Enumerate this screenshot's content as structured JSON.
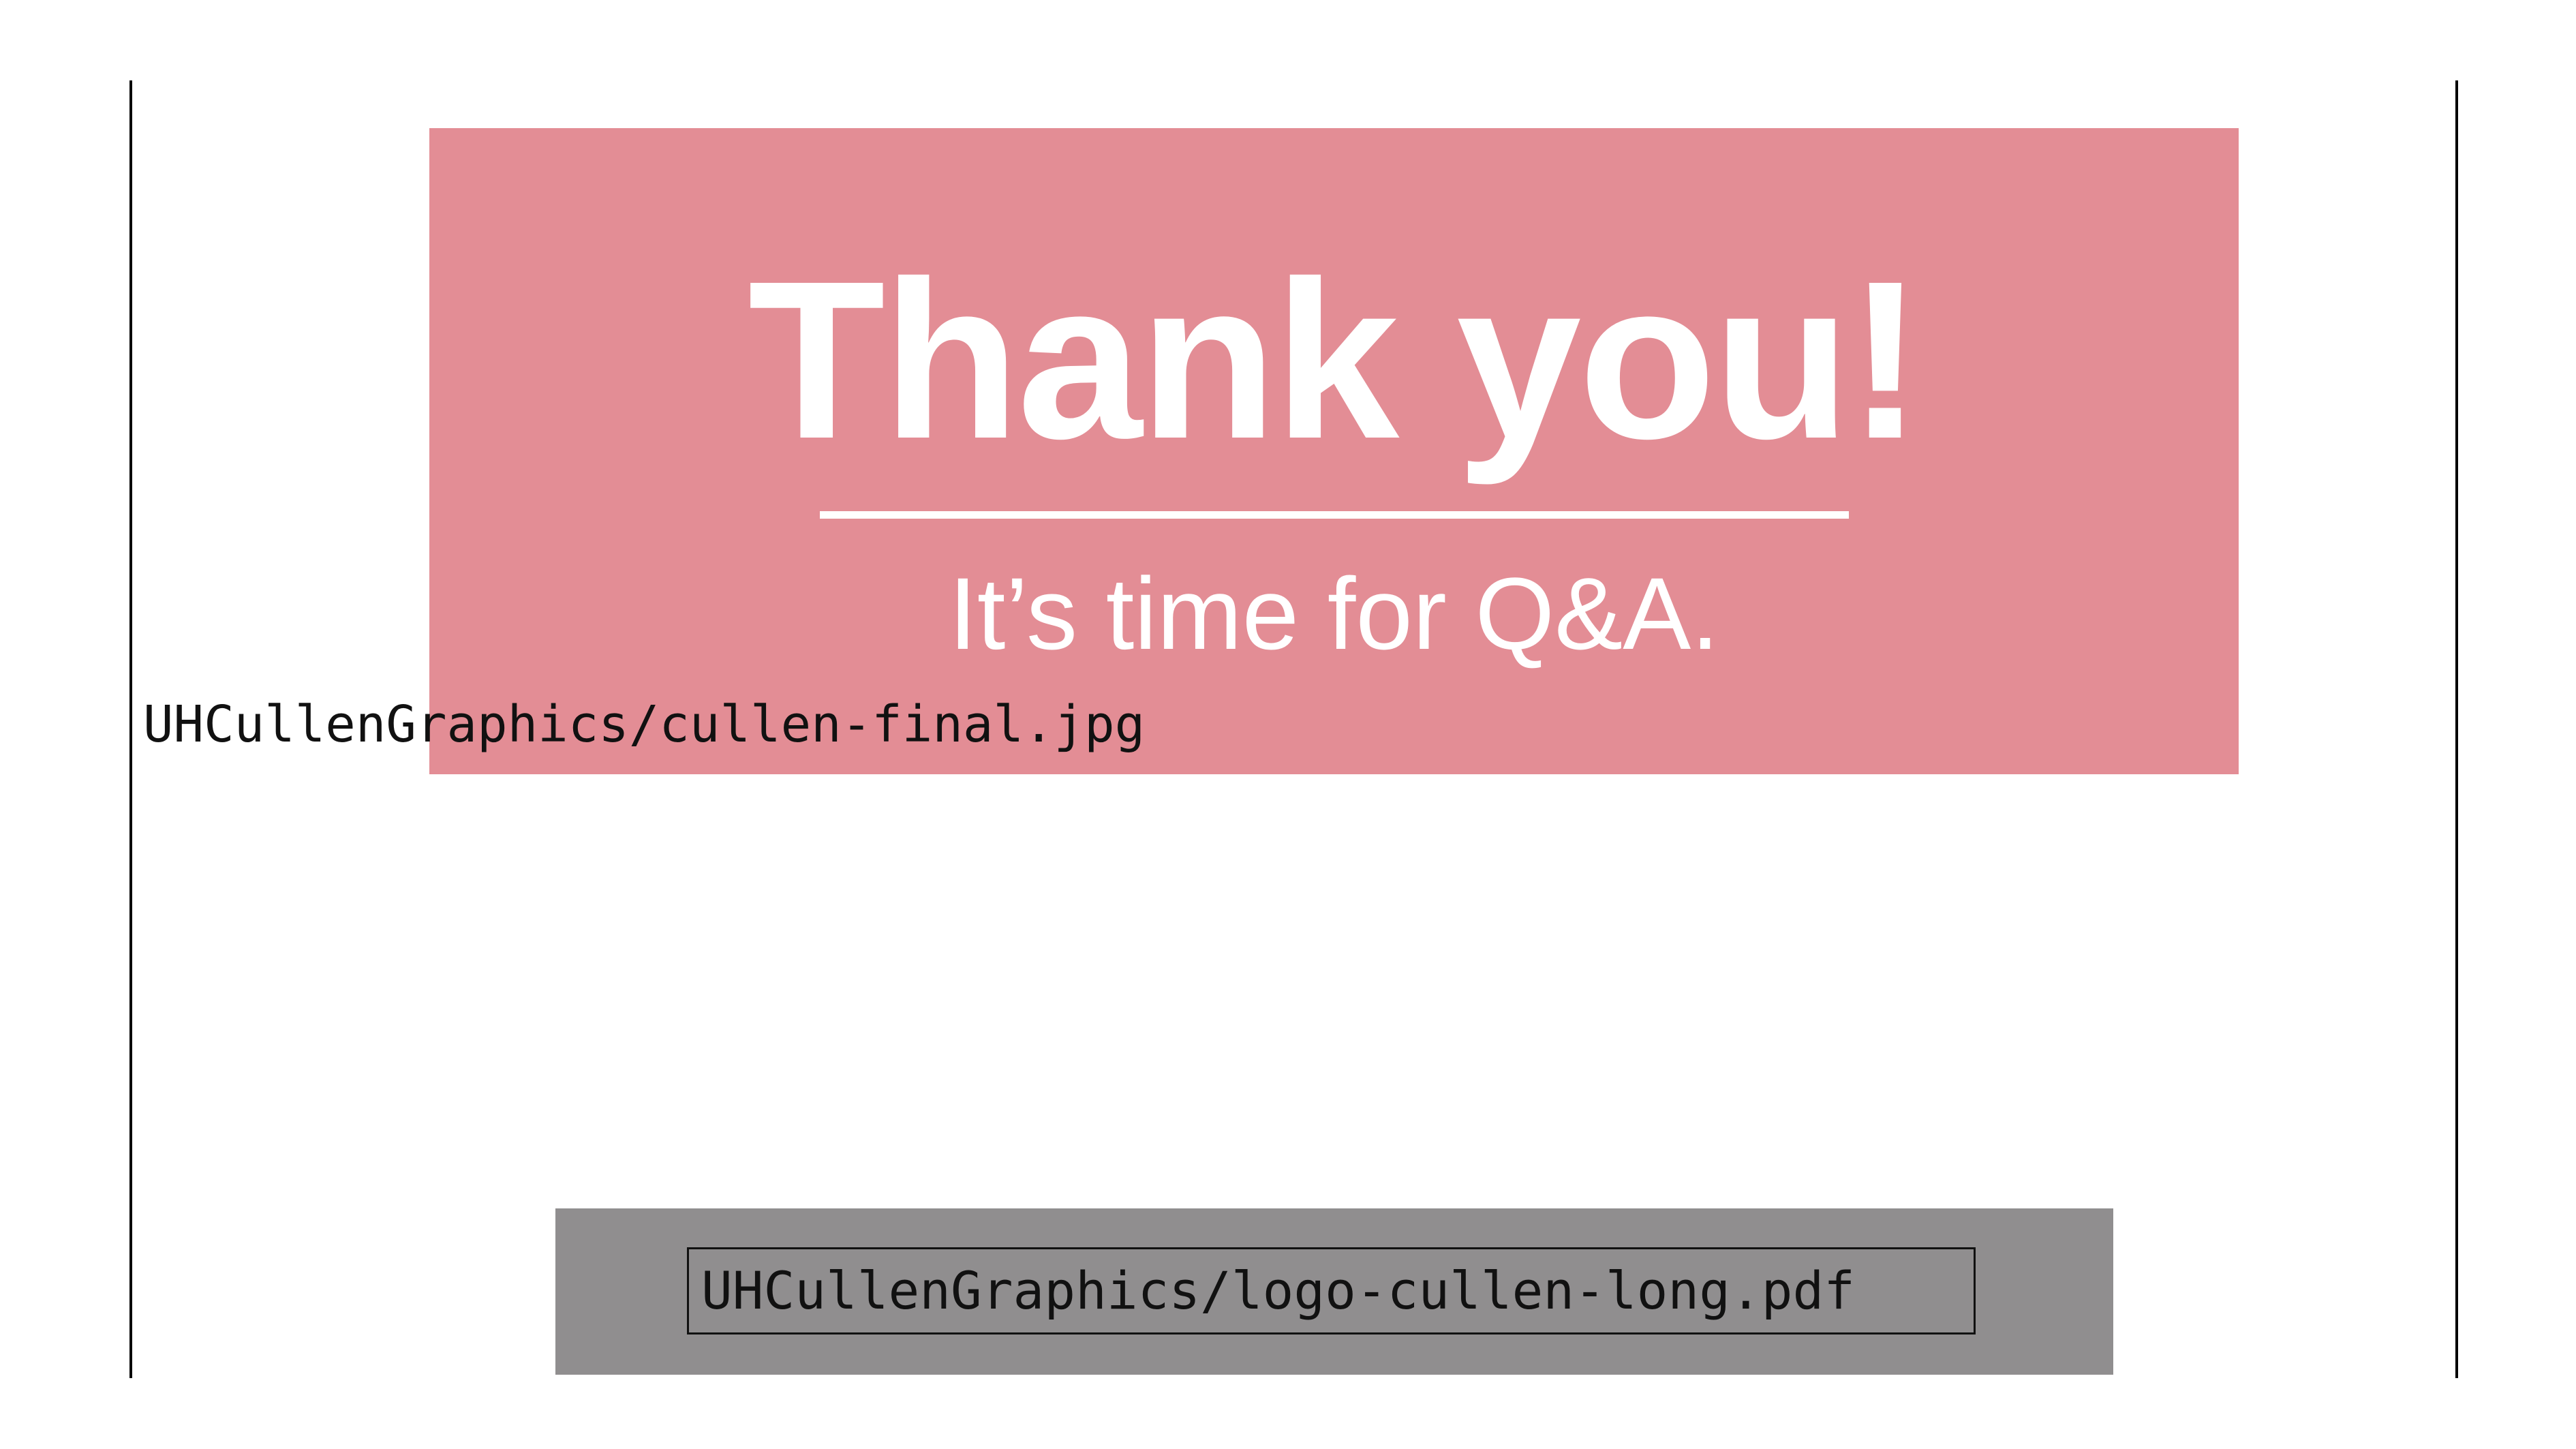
{
  "colors": {
    "banner_bg": "#e38d95",
    "footer_bg": "#908e8f",
    "banner_text": "#ffffff",
    "overlay_text_on_banner": "#6b1f28"
  },
  "banner": {
    "title": "Thank you!",
    "subtitle": "It’s time for Q&A."
  },
  "missing_image": {
    "path": "UHCullenGraphics/cullen-final.jpg"
  },
  "footer": {
    "logo_path": "UHCullenGraphics/logo-cullen-long.pdf"
  }
}
